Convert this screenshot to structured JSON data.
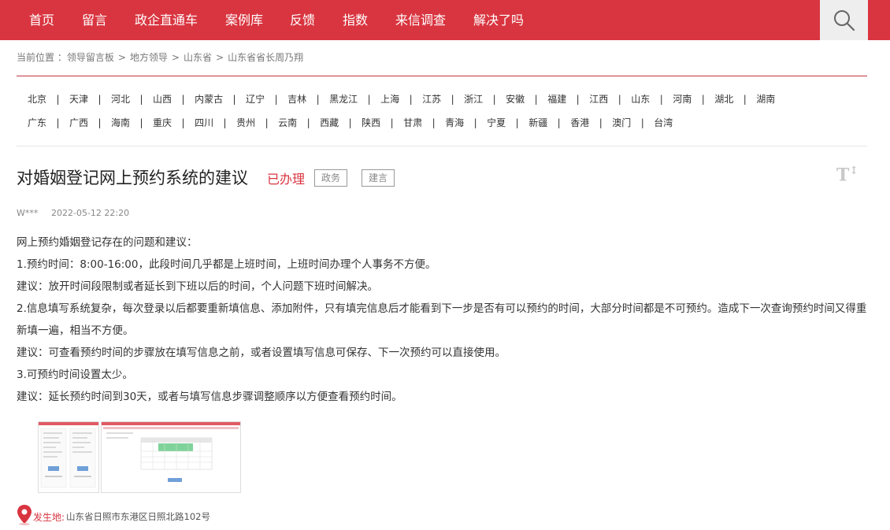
{
  "nav": {
    "items": [
      "首页",
      "留言",
      "政企直通车",
      "案例库",
      "反馈",
      "指数",
      "来信调查",
      "解决了吗"
    ],
    "accent": "#d93540"
  },
  "breadcrumb": {
    "prefix": "当前位置 ：",
    "items": [
      "领导留言板",
      "地方领导",
      "山东省",
      "山东省省长周乃翔"
    ],
    "separator": ">"
  },
  "provinces": {
    "row1": [
      "北京",
      "天津",
      "河北",
      "山西",
      "内蒙古",
      "辽宁",
      "吉林",
      "黑龙江",
      "上海",
      "江苏",
      "浙江",
      "安徽",
      "福建",
      "江西",
      "山东",
      "河南",
      "湖北",
      "湖南"
    ],
    "row2": [
      "广东",
      "广西",
      "海南",
      "重庆",
      "四川",
      "贵州",
      "云南",
      "西藏",
      "陕西",
      "甘肃",
      "青海",
      "宁夏",
      "新疆",
      "香港",
      "澳门",
      "台湾"
    ],
    "separator": "|"
  },
  "message": {
    "title": "对婚姻登记网上预约系统的建议",
    "status": "已办理",
    "tags": [
      "政务",
      "建言"
    ],
    "font_toggle": "T",
    "author": "W***",
    "date": "2022-05-12 22:20",
    "paragraphs": [
      "网上预约婚姻登记存在的问题和建议：",
      "1.预约时间：8:00-16:00，此段时间几乎都是上班时间，上班时间办理个人事务不方便。",
      "建议：放开时间段限制或者延长到下班以后的时间，个人问题下班时间解决。",
      "2.信息填写系统复杂，每次登录以后都要重新填信息、添加附件，只有填完信息后才能看到下一步是否有可以预约的时间，大部分时间都是不可预约。造成下一次查询预约时间又得重新填一遍，相当不方便。",
      "建议：可查看预约时间的步骤放在填写信息之前，或者设置填写信息可保存、下一次预约可以直接使用。",
      "3.可预约时间设置太少。",
      "建议：延长预约时间到30天，或者与填写信息步骤调整顺序以方便查看预约时间。"
    ],
    "location_label": "发生地:",
    "location": "山东省日照市东港区日照北路102号"
  },
  "icons": {
    "search": "search-icon",
    "font_size": "font-size-icon",
    "location": "map-pin-icon"
  }
}
